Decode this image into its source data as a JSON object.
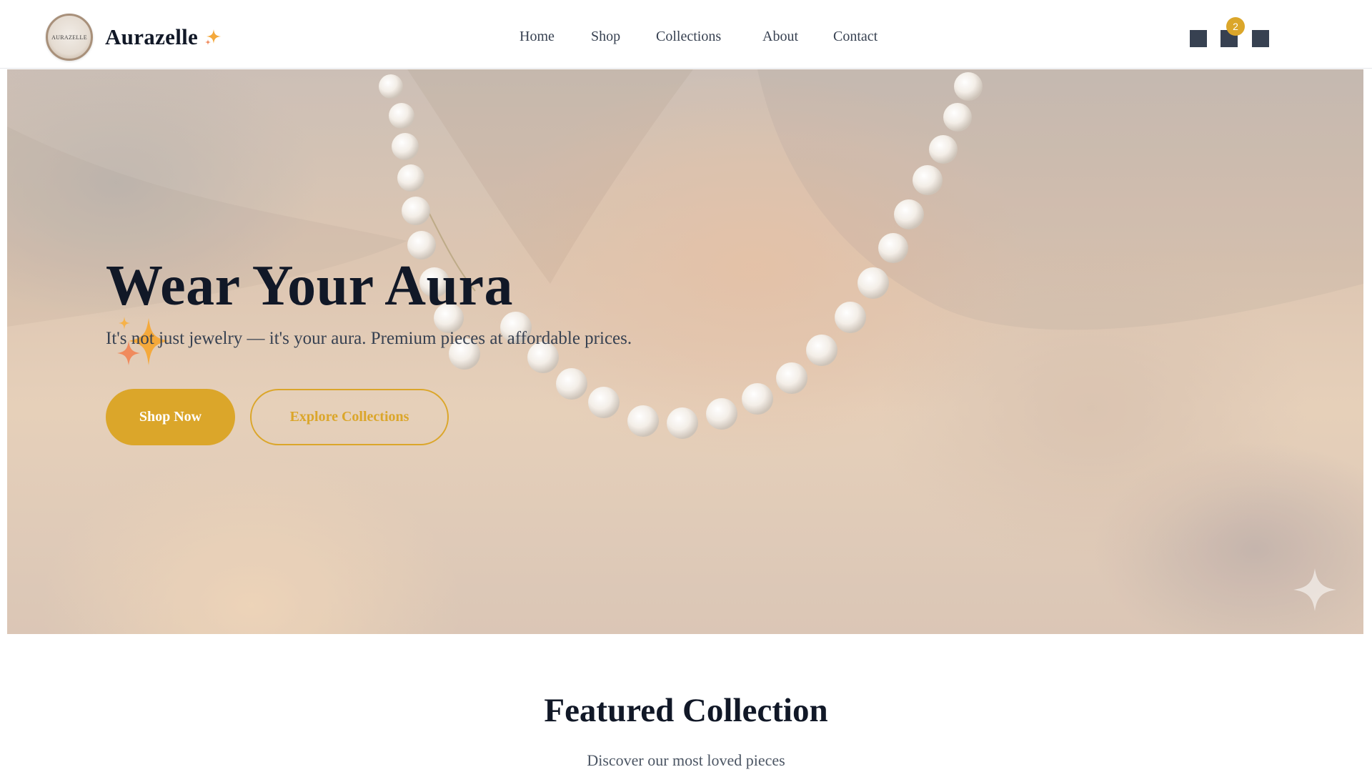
{
  "header": {
    "logo_text": "AURAZELLE",
    "brand_name": "Aurazelle",
    "nav": [
      {
        "label": "Home"
      },
      {
        "label": "Shop"
      },
      {
        "label": "Collections"
      },
      {
        "label": "About"
      },
      {
        "label": "Contact"
      }
    ],
    "icons": [
      "search-icon",
      "cart-icon",
      "menu-icon"
    ],
    "cart_count": "2"
  },
  "hero": {
    "title": "Wear Your Aura",
    "subtitle": "It's not just jewelry — it's your aura. Premium pieces at affordable prices.",
    "primary_button": "Shop Now",
    "secondary_button": "Explore Collections",
    "image": "pearl-necklace-photo"
  },
  "featured": {
    "title": "Featured Collection",
    "subtitle": "Discover our most loved pieces"
  },
  "colors": {
    "accent": "#dba62a",
    "text_dark": "#111827",
    "text_muted": "#374151",
    "icon": "#374151"
  }
}
